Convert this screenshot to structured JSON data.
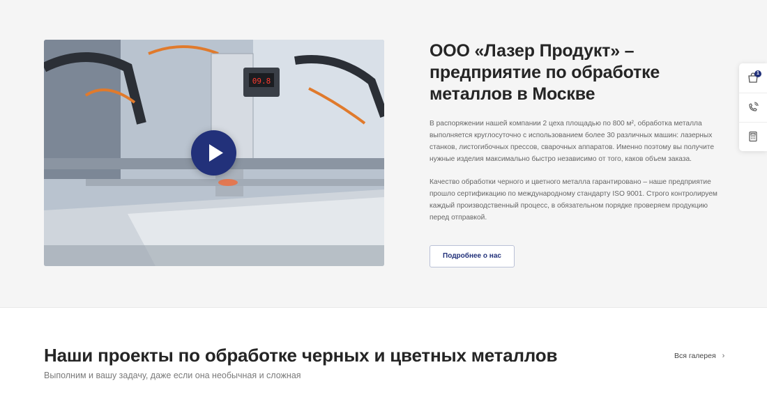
{
  "about": {
    "title_lines": [
      "ООО «Лазер Продукт» –",
      "предприятие по обработке",
      "металлов в Москве"
    ],
    "paragraphs": [
      "В распоряжении нашей компании 2 цеха площадью по 800 м², обработка металла выполняется круглосуточно с использованием более 30 различных машин: лазерных станков, листогибочных прессов, сварочных аппаратов. Именно поэтому вы получите нужные изделия максимально быстро независимо от того, каков объем заказа.",
      "Качество обработки черного и цветного металла гарантировано – наше предприятие прошло сертификацию по международному стандарту ISO 9001. Строго контролируем каждый производственный процесс, в обязательном порядке проверяем продукцию перед отправкой."
    ],
    "more_button_label": "Подробнее о нас",
    "video": {
      "display_readout": "09.8",
      "play_icon": "play-icon"
    }
  },
  "rail": {
    "cart_icon": "cart-icon",
    "cart_count": "1",
    "callback_icon": "phone-callback-icon",
    "calculator_icon": "calculator-icon"
  },
  "projects": {
    "title": "Наши проекты по обработке черных и цветных металлов",
    "subtitle": "Выполним и вашу задачу, даже если она необычная и сложная",
    "gallery_link": "Вся галерея",
    "gallery_chevron": "›"
  },
  "colors": {
    "accent": "#22317a",
    "section_bg": "#f5f5f5",
    "text_dark": "#252525",
    "text_muted": "#666666"
  }
}
